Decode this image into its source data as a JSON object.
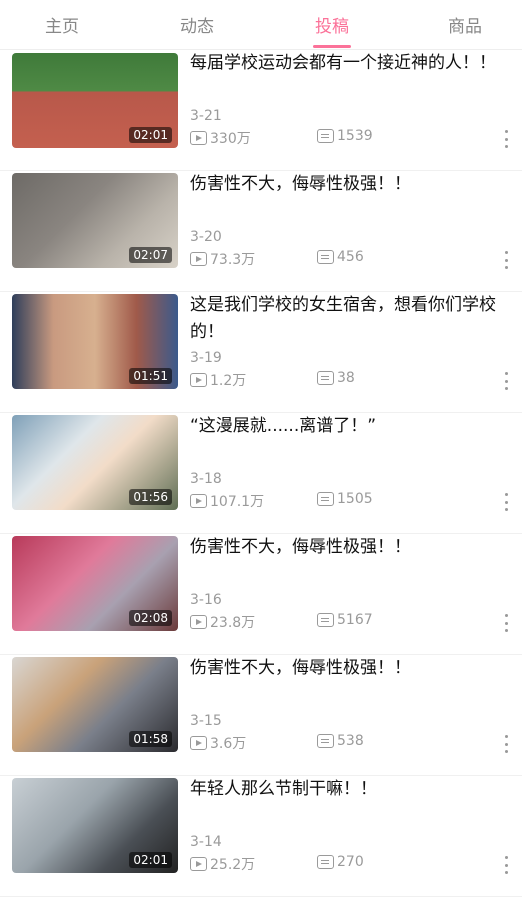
{
  "tabs": [
    {
      "label": "主页"
    },
    {
      "label": "动态"
    },
    {
      "label": "投稿"
    },
    {
      "label": "商品"
    }
  ],
  "active_tab": "投稿",
  "accent_color": "#fb7299",
  "videos": [
    {
      "title": "每届学校运动会都有一个接近神的人！！",
      "date": "3-21",
      "views": "330万",
      "danmaku": "1539",
      "duration": "02:01"
    },
    {
      "title": "伤害性不大，侮辱性极强！！",
      "date": "3-20",
      "views": "73.3万",
      "danmaku": "456",
      "duration": "02:07"
    },
    {
      "title": "这是我们学校的女生宿舍，想看你们学校的！",
      "date": "3-19",
      "views": "1.2万",
      "danmaku": "38",
      "duration": "01:51"
    },
    {
      "title": "“这漫展就......离谱了！”",
      "date": "3-18",
      "views": "107.1万",
      "danmaku": "1505",
      "duration": "01:56"
    },
    {
      "title": "伤害性不大，侮辱性极强！！",
      "date": "3-16",
      "views": "23.8万",
      "danmaku": "5167",
      "duration": "02:08"
    },
    {
      "title": "伤害性不大，侮辱性极强！！",
      "date": "3-15",
      "views": "3.6万",
      "danmaku": "538",
      "duration": "01:58"
    },
    {
      "title": "年轻人那么节制干嘛！！",
      "date": "3-14",
      "views": "25.2万",
      "danmaku": "270",
      "duration": "02:01"
    }
  ]
}
